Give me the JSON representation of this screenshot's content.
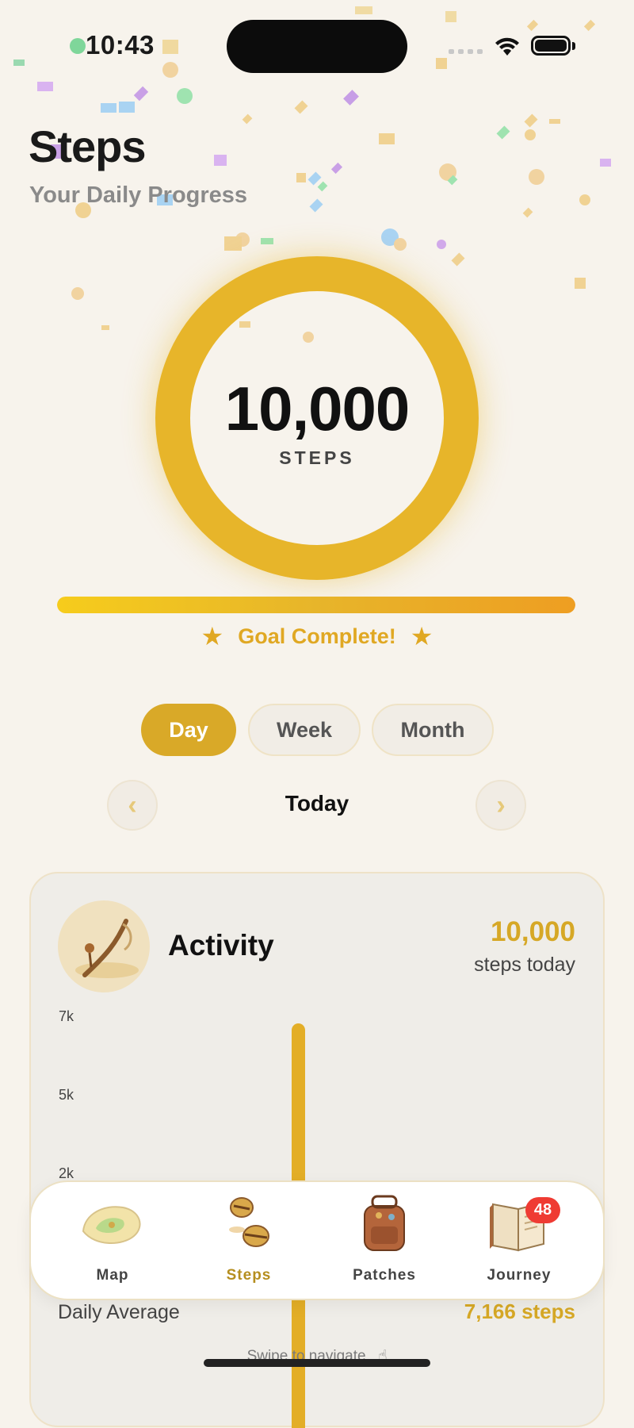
{
  "status_bar": {
    "time": "10:43"
  },
  "header": {
    "title": "Steps",
    "subtitle": "Your Daily Progress"
  },
  "ring": {
    "value": "10,000",
    "unit": "STEPS",
    "progress": 1.0
  },
  "progress": {
    "fraction": 1.0,
    "goal_text": "Goal Complete!"
  },
  "period_tabs": {
    "day": "Day",
    "week": "Week",
    "month": "Month",
    "selected": "Day"
  },
  "date_nav": {
    "label": "Today",
    "prev_icon": "chevron-left-icon",
    "next_icon": "chevron-right-icon"
  },
  "activity": {
    "title": "Activity",
    "value": "10,000",
    "caption": "steps today",
    "avatar_icon": "walking-stick-icon"
  },
  "chart_data": {
    "type": "bar",
    "yticks": [
      "7k",
      "5k",
      "2k"
    ],
    "bars": [
      {
        "value": 10000
      }
    ]
  },
  "summary": {
    "label": "Daily Average",
    "value": "7,166 steps"
  },
  "tabbar": {
    "items": [
      {
        "label": "Map",
        "icon": "island-map-icon",
        "active": false
      },
      {
        "label": "Steps",
        "icon": "sandals-icon",
        "active": true
      },
      {
        "label": "Patches",
        "icon": "backpack-icon",
        "active": false
      },
      {
        "label": "Journey",
        "icon": "journal-icon",
        "active": false
      }
    ],
    "journey_badge": "48"
  },
  "hint": "Swipe to navigate",
  "colors": {
    "accent": "#e7b52a",
    "accent_text": "#d6a826",
    "badge": "#ef3b33",
    "background": "#f7f3ec"
  }
}
